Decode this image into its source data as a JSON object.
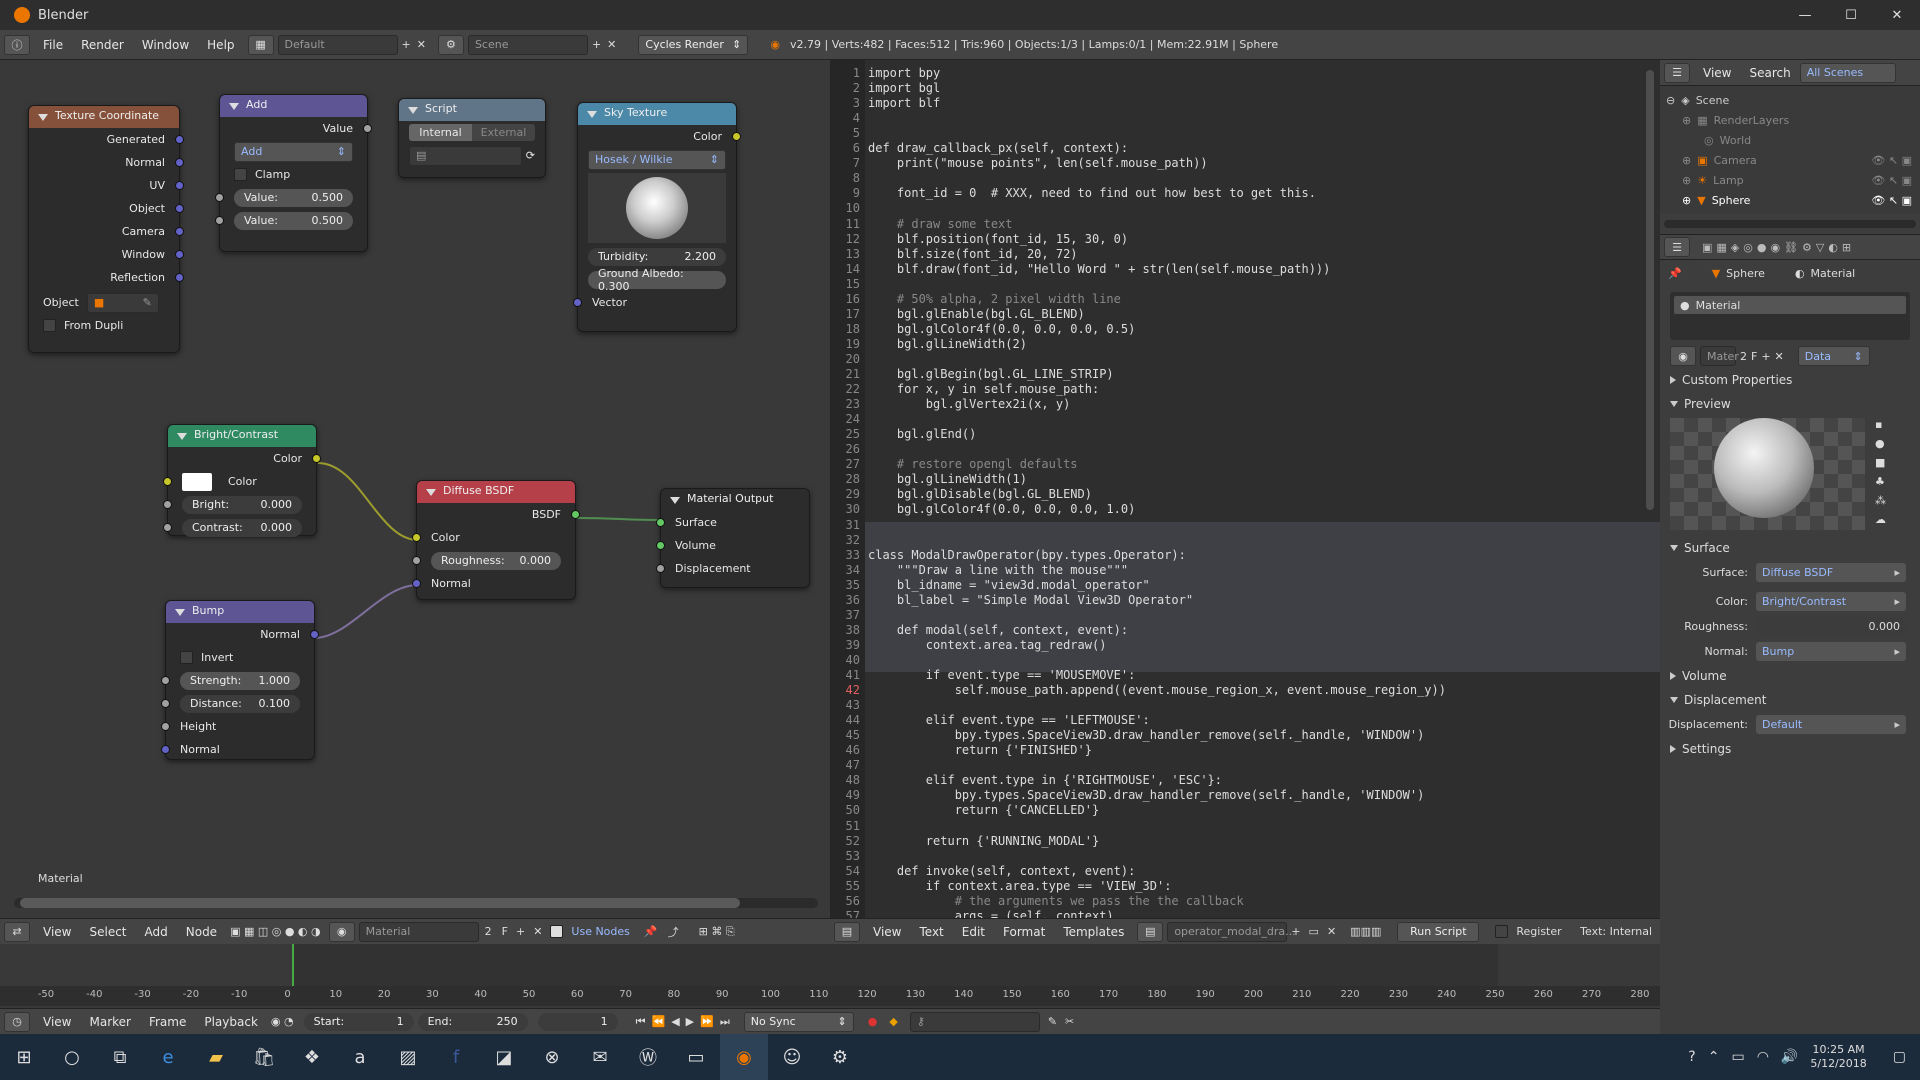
{
  "window": {
    "title": "Blender"
  },
  "menu": {
    "items": [
      "File",
      "Render",
      "Window",
      "Help"
    ],
    "layout": "Default",
    "scene": "Scene",
    "engine": "Cycles Render",
    "stats": "v2.79 | Verts:482 | Faces:512 | Tris:960 | Objects:1/3 | Lamps:0/1 | Mem:22.91M | Sphere"
  },
  "nodes": {
    "texcoord": {
      "title": "Texture Coordinate",
      "outputs": [
        "Generated",
        "Normal",
        "UV",
        "Object",
        "Camera",
        "Window",
        "Reflection"
      ],
      "object_label": "Object",
      "from_dupli": "From Dupli"
    },
    "add": {
      "title": "Add",
      "output": "Value",
      "op": "Add",
      "clamp": "Clamp",
      "v1_label": "Value:",
      "v1": "0.500",
      "v2_label": "Value:",
      "v2": "0.500"
    },
    "script": {
      "title": "Script",
      "tab_internal": "Internal",
      "tab_external": "External"
    },
    "sky": {
      "title": "Sky Texture",
      "output": "Color",
      "model": "Hosek / Wilkie",
      "turbidity_label": "Turbidity:",
      "turbidity": "2.200",
      "ground_albedo": "Ground Albedo: 0.300",
      "input": "Vector"
    },
    "bright": {
      "title": "Bright/Contrast",
      "output": "Color",
      "color_label": "Color",
      "bright_label": "Bright:",
      "bright": "0.000",
      "contrast_label": "Contrast:",
      "contrast": "0.000"
    },
    "diffuse": {
      "title": "Diffuse BSDF",
      "output": "BSDF",
      "color": "Color",
      "roughness_label": "Roughness:",
      "roughness": "0.000",
      "normal": "Normal"
    },
    "output": {
      "title": "Material Output",
      "surface": "Surface",
      "volume": "Volume",
      "displacement": "Displacement"
    },
    "bump": {
      "title": "Bump",
      "output": "Normal",
      "invert": "Invert",
      "strength_label": "Strength:",
      "strength": "1.000",
      "distance_label": "Distance:",
      "distance": "0.100",
      "height": "Height",
      "normal": "Normal"
    }
  },
  "node_editor": {
    "material_label": "Material",
    "footer": {
      "view": "View",
      "select": "Select",
      "add": "Add",
      "node": "Node",
      "material": "Material",
      "users": "2",
      "fake": "F",
      "use_nodes": "Use Nodes"
    }
  },
  "code": [
    "import bpy",
    "import bgl",
    "import blf",
    "",
    "",
    "def draw_callback_px(self, context):",
    "    print(\"mouse points\", len(self.mouse_path))",
    "",
    "    font_id = 0  # XXX, need to find out how best to get this.",
    "",
    "    # draw some text",
    "    blf.position(font_id, 15, 30, 0)",
    "    blf.size(font_id, 20, 72)",
    "    blf.draw(font_id, \"Hello Word \" + str(len(self.mouse_path)))",
    "",
    "    # 50% alpha, 2 pixel width line",
    "    bgl.glEnable(bgl.GL_BLEND)",
    "    bgl.glColor4f(0.0, 0.0, 0.0, 0.5)",
    "    bgl.glLineWidth(2)",
    "",
    "    bgl.glBegin(bgl.GL_LINE_STRIP)",
    "    for x, y in self.mouse_path:",
    "        bgl.glVertex2i(x, y)",
    "",
    "    bgl.glEnd()",
    "",
    "    # restore opengl defaults",
    "    bgl.glLineWidth(1)",
    "    bgl.glDisable(bgl.GL_BLEND)",
    "    bgl.glColor4f(0.0, 0.0, 0.0, 1.0)",
    "",
    "",
    "class ModalDrawOperator(bpy.types.Operator):",
    "    \"\"\"Draw a line with the mouse\"\"\"",
    "    bl_idname = \"view3d.modal_operator\"",
    "    bl_label = \"Simple Modal View3D Operator\"",
    "",
    "    def modal(self, context, event):",
    "        context.area.tag_redraw()",
    "",
    "        if event.type == 'MOUSEMOVE':",
    "            self.mouse_path.append((event.mouse_region_x, event.mouse_region_y))",
    "",
    "        elif event.type == 'LEFTMOUSE':",
    "            bpy.types.SpaceView3D.draw_handler_remove(self._handle, 'WINDOW')",
    "            return {'FINISHED'}",
    "",
    "        elif event.type in {'RIGHTMOUSE', 'ESC'}:",
    "            bpy.types.SpaceView3D.draw_handler_remove(self._handle, 'WINDOW')",
    "            return {'CANCELLED'}",
    "",
    "        return {'RUNNING_MODAL'}",
    "",
    "    def invoke(self, context, event):",
    "        if context.area.type == 'VIEW_3D':",
    "            # the arguments we pass the the callback",
    "            args = (self, context)"
  ],
  "text_footer": {
    "view": "View",
    "text": "Text",
    "edit": "Edit",
    "format": "Format",
    "templates": "Templates",
    "filename": "operator_modal_dra...",
    "run": "Run Script",
    "register": "Register",
    "status": "Text: Internal"
  },
  "outliner": {
    "view": "View",
    "search": "Search",
    "all_scenes": "All Scenes",
    "rows": [
      "Scene",
      "RenderLayers",
      "World",
      "Camera",
      "Lamp",
      "Sphere"
    ]
  },
  "properties": {
    "object": "Sphere",
    "material": "Material",
    "slot": "Material",
    "mat_field": "Mater",
    "users": "2",
    "fake": "F",
    "data": "Data",
    "custom_props": "Custom Properties",
    "preview": "Preview",
    "surface_panel": "Surface",
    "surface_label": "Surface:",
    "surface_value": "Diffuse BSDF",
    "color_label": "Color:",
    "color_value": "Bright/Contrast",
    "roughness_label": "Roughness:",
    "roughness_value": "0.000",
    "normal_label": "Normal:",
    "normal_value": "Bump",
    "volume": "Volume",
    "displacement_panel": "Displacement",
    "displacement_label": "Displacement:",
    "displacement_value": "Default",
    "settings": "Settings"
  },
  "timeline": {
    "ticks": [
      "-50",
      "-40",
      "-30",
      "-20",
      "-10",
      "0",
      "10",
      "20",
      "30",
      "40",
      "50",
      "60",
      "70",
      "80",
      "90",
      "100",
      "110",
      "120",
      "130",
      "140",
      "150",
      "160",
      "170",
      "180",
      "190",
      "200",
      "210",
      "220",
      "230",
      "240",
      "250",
      "260",
      "270",
      "280"
    ],
    "view": "View",
    "marker": "Marker",
    "frame": "Frame",
    "playback": "Playback",
    "start_label": "Start:",
    "start": "1",
    "end_label": "End:",
    "end": "250",
    "current": "1",
    "sync": "No Sync"
  },
  "taskbar": {
    "time": "10:25 AM",
    "date": "5/12/2018"
  },
  "colors": {
    "accent": "#5680c2",
    "texcoord_header": "#863a3a",
    "shader_header": "#2f8a62",
    "converter_header": "#5d5594",
    "output_header": "#b5404a"
  }
}
